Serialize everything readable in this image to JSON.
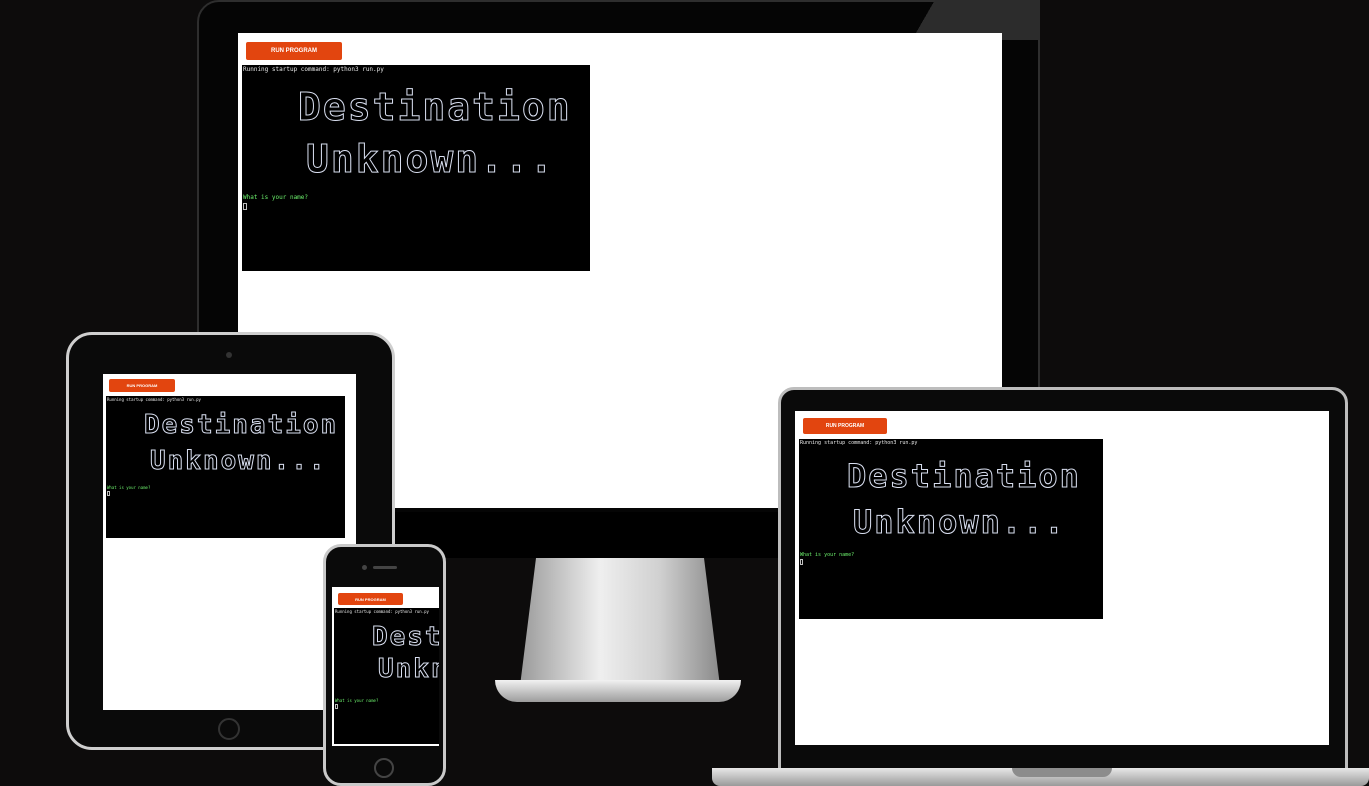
{
  "app": {
    "run_button_label": "RUN PROGRAM",
    "startup_text": "Running startup command: python3 run.py",
    "title_line1": "Destination",
    "title_line2": "Unknown...",
    "prompt_text": "What is your name?"
  },
  "devices": [
    "monitor",
    "tablet",
    "laptop",
    "phone"
  ]
}
